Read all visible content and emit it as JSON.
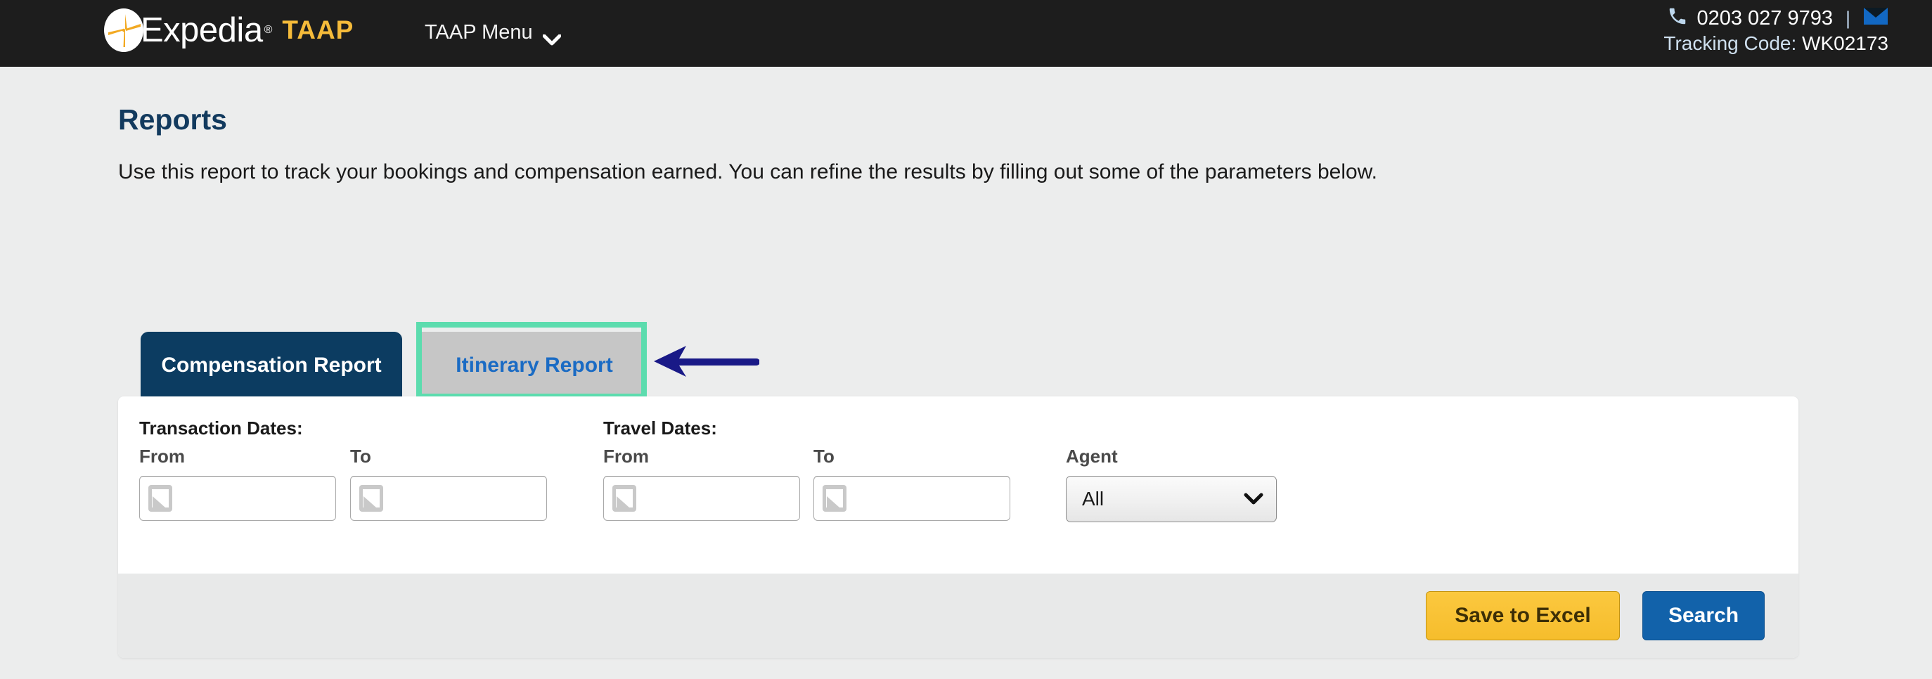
{
  "header": {
    "brand_name": "Expedia",
    "brand_reg": "®",
    "brand_sub": "TAAP",
    "menu_label": "TAAP Menu",
    "menu_icon": "chevron-down-icon",
    "phone_icon": "phone-icon",
    "phone_number": "0203 027 9793",
    "separator": "|",
    "email_icon": "envelope-icon",
    "tracking_label": "Tracking Code:",
    "tracking_code": "WK02173",
    "background_color": "#1d1d1d",
    "brand_accent_color": "#f5bb3a"
  },
  "page": {
    "title": "Reports",
    "description": "Use this report to track your bookings and compensation earned. You can refine the results by filling out some of the parameters below.",
    "title_color": "#123a5e",
    "background_color": "#eceded"
  },
  "tabs": [
    {
      "label": "Compensation Report",
      "state": "active",
      "bg_color": "#0c3c61",
      "text_color": "#ffffff"
    },
    {
      "label": "Itinerary Report",
      "state": "inactive",
      "bg_color": "#c6c6c6",
      "text_color": "#1a6bc4"
    }
  ],
  "annotations": {
    "highlight_target": "Itinerary Report",
    "highlight_color": "#5cdcae",
    "arrow_color": "#191987",
    "arrow_direction": "left"
  },
  "form": {
    "transaction_dates": {
      "heading": "Transaction Dates:",
      "from": {
        "label": "From",
        "value": "",
        "placeholder": "",
        "icon": "broken-image-icon"
      },
      "to": {
        "label": "To",
        "value": "",
        "placeholder": "",
        "icon": "broken-image-icon"
      }
    },
    "travel_dates": {
      "heading": "Travel Dates:",
      "from": {
        "label": "From",
        "value": "",
        "placeholder": "",
        "icon": "broken-image-icon"
      },
      "to": {
        "label": "To",
        "value": "",
        "placeholder": "",
        "icon": "broken-image-icon"
      }
    },
    "agent": {
      "label": "Agent",
      "value": "All",
      "icon": "chevron-down-icon"
    }
  },
  "footer": {
    "save_label": "Save to Excel",
    "search_label": "Search",
    "save_color": "#f6bd2c",
    "search_color": "#1262aa"
  }
}
